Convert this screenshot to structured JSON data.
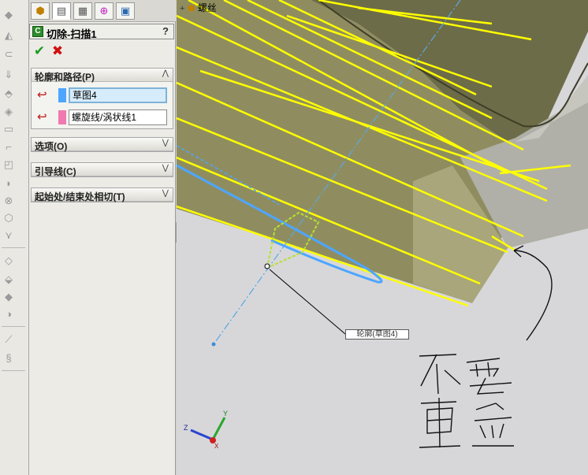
{
  "property_manager": {
    "tabs": [
      {
        "icon": "feature-manager-icon"
      },
      {
        "icon": "property-manager-icon",
        "active": true
      },
      {
        "icon": "configuration-manager-icon"
      },
      {
        "icon": "dimxpert-icon"
      },
      {
        "icon": "display-manager-icon"
      }
    ],
    "title": "切除-扫描1",
    "help_label": "?",
    "ok_label": "✔",
    "cancel_label": "✖",
    "groups": {
      "profile_path": {
        "title": "轮廓和路径(P)",
        "expanded": true,
        "profile_value": "草图4",
        "profile_color": "#4da6ff",
        "path_value": "螺旋线/涡状线1",
        "path_color": "#f07ab0"
      },
      "options": {
        "title": "选项(O)",
        "expanded": false
      },
      "guide_curves": {
        "title": "引导线(C)",
        "expanded": false
      },
      "tangency": {
        "title": "起始处/结束处相切(T)",
        "expanded": false
      }
    }
  },
  "graphics": {
    "tree_root_label": "螺丝",
    "callout_label": "轮廓(草图4)",
    "triad": {
      "x": "X",
      "y": "Y",
      "z": "Z"
    },
    "colors": {
      "helix": "#ffff00",
      "solid_face": "#8b8a5c",
      "sketch_profile": "#4da6ff",
      "background": "#d7d7da"
    },
    "annotation_handwriting": "不要重合"
  }
}
